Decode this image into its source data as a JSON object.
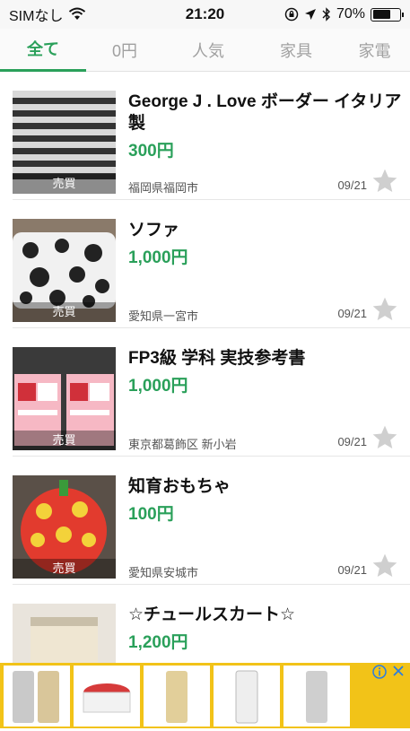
{
  "status_bar": {
    "carrier": "SIMなし",
    "time": "21:20",
    "battery_percent": "70%",
    "battery_level": 0.7
  },
  "tabs": [
    {
      "label": "全て",
      "active": true
    },
    {
      "label": "0円",
      "active": false
    },
    {
      "label": "人気",
      "active": false
    },
    {
      "label": "家具",
      "active": false
    },
    {
      "label": "家電",
      "active": false
    }
  ],
  "items": [
    {
      "title": "George J . Love ボーダー イタリア製",
      "price": "300円",
      "location": "福岡県福岡市",
      "date": "09/21",
      "badge": "売買"
    },
    {
      "title": "ソファ",
      "price": "1,000円",
      "location": "愛知県一宮市",
      "date": "09/21",
      "badge": "売買"
    },
    {
      "title": "FP3級 学科 実技参考書",
      "price": "1,000円",
      "location": "東京都葛飾区 新小岩",
      "date": "09/21",
      "badge": "売買"
    },
    {
      "title": "知育おもちゃ",
      "price": "100円",
      "location": "愛知県安城市",
      "date": "09/21",
      "badge": "売買"
    },
    {
      "title": "☆チュールスカート☆",
      "price": "1,200円",
      "location": "",
      "date": "",
      "badge": ""
    }
  ],
  "colors": {
    "accent": "#2aa05a",
    "ad_background": "#f2c318"
  }
}
